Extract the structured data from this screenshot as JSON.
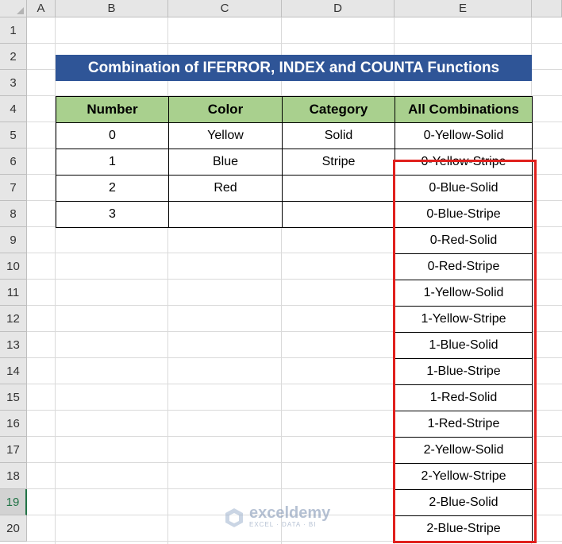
{
  "columns": [
    "A",
    "B",
    "C",
    "D",
    "E"
  ],
  "rows": [
    "1",
    "2",
    "3",
    "4",
    "5",
    "6",
    "7",
    "8",
    "9",
    "10",
    "11",
    "12",
    "13",
    "14",
    "15",
    "16",
    "17",
    "18",
    "19",
    "20"
  ],
  "selected_row": "19",
  "title": "Combination of IFERROR, INDEX and COUNTA Functions",
  "table": {
    "headers": [
      "Number",
      "Color",
      "Category",
      "All Combinations"
    ],
    "number": [
      "0",
      "1",
      "2",
      "3"
    ],
    "color": [
      "Yellow",
      "Blue",
      "Red",
      ""
    ],
    "category": [
      "Solid",
      "Stripe",
      "",
      ""
    ],
    "combinations": [
      "0-Yellow-Solid",
      "0-Yellow-Stripe",
      "0-Blue-Solid",
      "0-Blue-Stripe",
      "0-Red-Solid",
      "0-Red-Stripe",
      "1-Yellow-Solid",
      "1-Yellow-Stripe",
      "1-Blue-Solid",
      "1-Blue-Stripe",
      "1-Red-Solid",
      "1-Red-Stripe",
      "2-Yellow-Solid",
      "2-Yellow-Stripe",
      "2-Blue-Solid",
      "2-Blue-Stripe"
    ]
  },
  "watermark": {
    "name": "exceldemy",
    "tagline": "EXCEL · DATA · BI"
  },
  "colors": {
    "title_bg": "#2f5597",
    "header_bg": "#a9d08e",
    "highlight": "#e0201d",
    "selected": "#217346"
  }
}
